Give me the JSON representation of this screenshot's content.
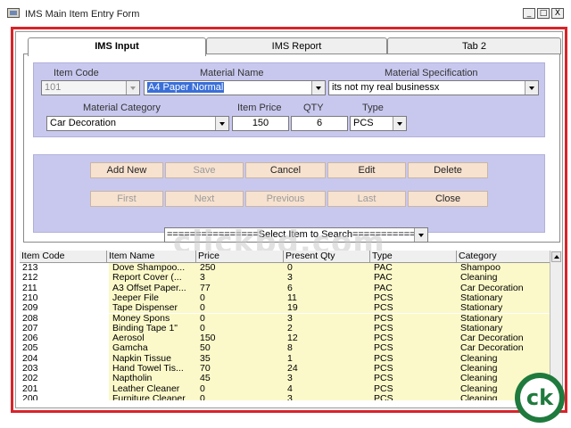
{
  "window": {
    "title": "IMS Main Item Entry Form",
    "controls": {
      "minimize": "_",
      "maximize": "□",
      "close": "X"
    }
  },
  "tabs": [
    {
      "label": "IMS Input",
      "active": true
    },
    {
      "label": "IMS Report",
      "active": false
    },
    {
      "label": "Tab 2",
      "active": false
    }
  ],
  "form": {
    "labels": {
      "item_code": "Item Code",
      "material_name": "Material  Name",
      "material_spec": "Material  Specification",
      "material_category": "Material  Category",
      "item_price": "Item Price",
      "qty": "QTY",
      "type": "Type"
    },
    "values": {
      "item_code": "101",
      "material_name": "A4 Paper Normal",
      "material_spec": "its not my real businessx",
      "material_category": "Car Decoration",
      "item_price": "150",
      "qty": "6",
      "type": "PCS"
    }
  },
  "buttons": {
    "add_new": "Add New",
    "save": "Save",
    "cancel": "Cancel",
    "edit": "Edit",
    "delete": "Delete",
    "first": "First",
    "next": "Next",
    "previous": "Previous",
    "last": "Last",
    "close": "Close"
  },
  "search": {
    "placeholder": "================Select Item to Search================="
  },
  "watermark": "clickbd.com",
  "table": {
    "columns": [
      "Item Code",
      "Item Name",
      "Price",
      "Present Qty",
      "Type",
      "Category"
    ],
    "rows": [
      [
        "213",
        "Dove Shampoo...",
        "250",
        "0",
        "PAC",
        "Shampoo"
      ],
      [
        "212",
        "Report Cover (...",
        "3",
        "3",
        "PAC",
        "Cleaning"
      ],
      [
        "211",
        "A3 Offset Paper...",
        "77",
        "6",
        "PAC",
        "Car Decoration"
      ],
      [
        "210",
        "Jeeper File",
        "0",
        "11",
        "PCS",
        "Stationary"
      ],
      [
        "209",
        "Tape Dispenser",
        "0",
        "19",
        "PCS",
        "Stationary"
      ],
      [
        "208",
        "Money Spons",
        "0",
        "3",
        "PCS",
        "Stationary"
      ],
      [
        "207",
        "Binding Tape 1\"",
        "0",
        "2",
        "PCS",
        "Stationary"
      ],
      [
        "206",
        "Aerosol",
        "150",
        "12",
        "PCS",
        "Car Decoration"
      ],
      [
        "205",
        "Gamcha",
        "50",
        "8",
        "PCS",
        "Car Decoration"
      ],
      [
        "204",
        "Napkin Tissue",
        "35",
        "1",
        "PCS",
        "Cleaning"
      ],
      [
        "203",
        "Hand Towel Tis...",
        "70",
        "24",
        "PCS",
        "Cleaning"
      ],
      [
        "202",
        "Naptholin",
        "45",
        "3",
        "PCS",
        "Cleaning"
      ],
      [
        "201",
        "Leather Cleaner",
        "0",
        "4",
        "PCS",
        "Cleaning"
      ],
      [
        "200",
        "Furniture Cleaner",
        "0",
        "3",
        "PCS",
        "Cleaning"
      ]
    ]
  },
  "logo": {
    "text": "ck"
  }
}
